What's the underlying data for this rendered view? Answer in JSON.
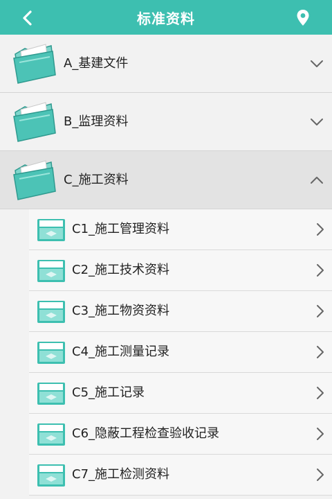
{
  "header": {
    "title": "标准资料",
    "back_icon": "back-arrow-icon",
    "location_icon": "location-pin-icon",
    "bg_color": "#3dbfb0"
  },
  "categories": [
    {
      "label": "A_基建文件",
      "state": "collapsed"
    },
    {
      "label": "B_监理资料",
      "state": "collapsed"
    },
    {
      "label": "C_施工资料",
      "state": "expanded"
    }
  ],
  "subitems": [
    {
      "label": "C1_施工管理资料"
    },
    {
      "label": "C2_施工技术资料"
    },
    {
      "label": "C3_施工物资资料"
    },
    {
      "label": "C4_施工测量记录"
    },
    {
      "label": "C5_施工记录"
    },
    {
      "label": "C6_隐蔽工程检查验收记录"
    },
    {
      "label": "C7_施工检测资料"
    }
  ]
}
